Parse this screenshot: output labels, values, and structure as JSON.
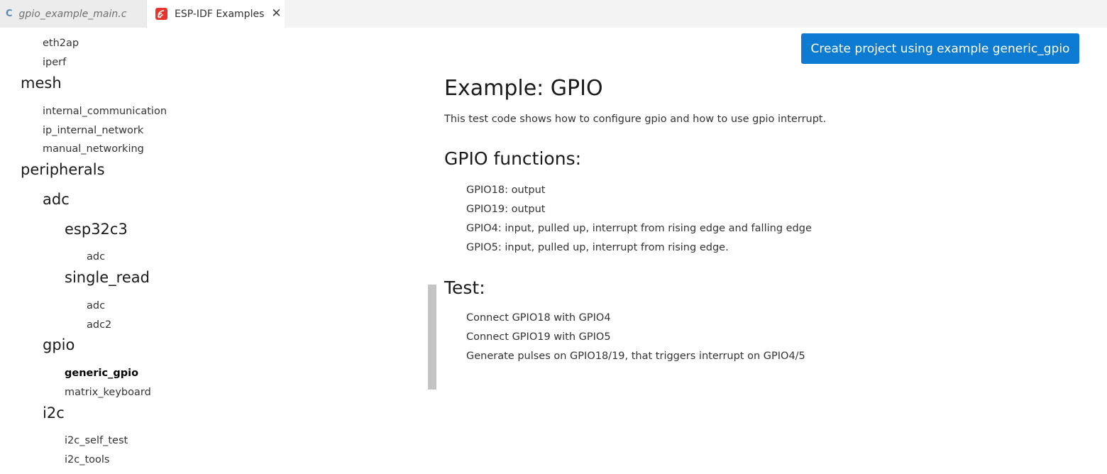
{
  "tabs": [
    {
      "icon": "c-file-icon",
      "icon_text": "C",
      "label": "gpio_example_main.c"
    },
    {
      "icon": "espressif-icon",
      "label": "ESP-IDF Examples",
      "close": "✕"
    }
  ],
  "sidebar": {
    "items": [
      {
        "label": "eth2ap",
        "kind": "leaf"
      },
      {
        "label": "iperf",
        "kind": "leaf"
      },
      {
        "label": "mesh",
        "kind": "heading"
      },
      {
        "label": "internal_communication",
        "kind": "leaf"
      },
      {
        "label": "ip_internal_network",
        "kind": "leaf"
      },
      {
        "label": "manual_networking",
        "kind": "leaf"
      },
      {
        "label": "peripherals",
        "kind": "heading"
      },
      {
        "label": "adc",
        "kind": "heading"
      },
      {
        "label": "esp32c3",
        "kind": "heading"
      },
      {
        "label": "adc",
        "kind": "leaf"
      },
      {
        "label": "single_read",
        "kind": "heading"
      },
      {
        "label": "adc",
        "kind": "leaf"
      },
      {
        "label": "adc2",
        "kind": "leaf"
      },
      {
        "label": "gpio",
        "kind": "heading"
      },
      {
        "label": "generic_gpio",
        "kind": "leaf",
        "selected": true
      },
      {
        "label": "matrix_keyboard",
        "kind": "leaf"
      },
      {
        "label": "i2c",
        "kind": "heading"
      },
      {
        "label": "i2c_self_test",
        "kind": "leaf"
      },
      {
        "label": "i2c_tools",
        "kind": "leaf"
      }
    ]
  },
  "content": {
    "create_button": "Create project using example generic_gpio",
    "title": "Example: GPIO",
    "description": "This test code shows how to configure gpio and how to use gpio interrupt.",
    "functions_heading": "GPIO functions:",
    "functions": [
      "GPIO18: output",
      "GPIO19: output",
      "GPIO4: input, pulled up, interrupt from rising edge and falling edge",
      "GPIO5: input, pulled up, interrupt from rising edge."
    ],
    "test_heading": "Test:",
    "test_steps": [
      "Connect GPIO18 with GPIO4",
      "Connect GPIO19 with GPIO5",
      "Generate pulses on GPIO18/19, that triggers interrupt on GPIO4/5"
    ]
  },
  "colors": {
    "button_bg": "#0e7bd2",
    "tabbar_bg": "#f3f3f3",
    "icon_red": "#e7352c",
    "quote_bar": "#c4c4c4"
  }
}
